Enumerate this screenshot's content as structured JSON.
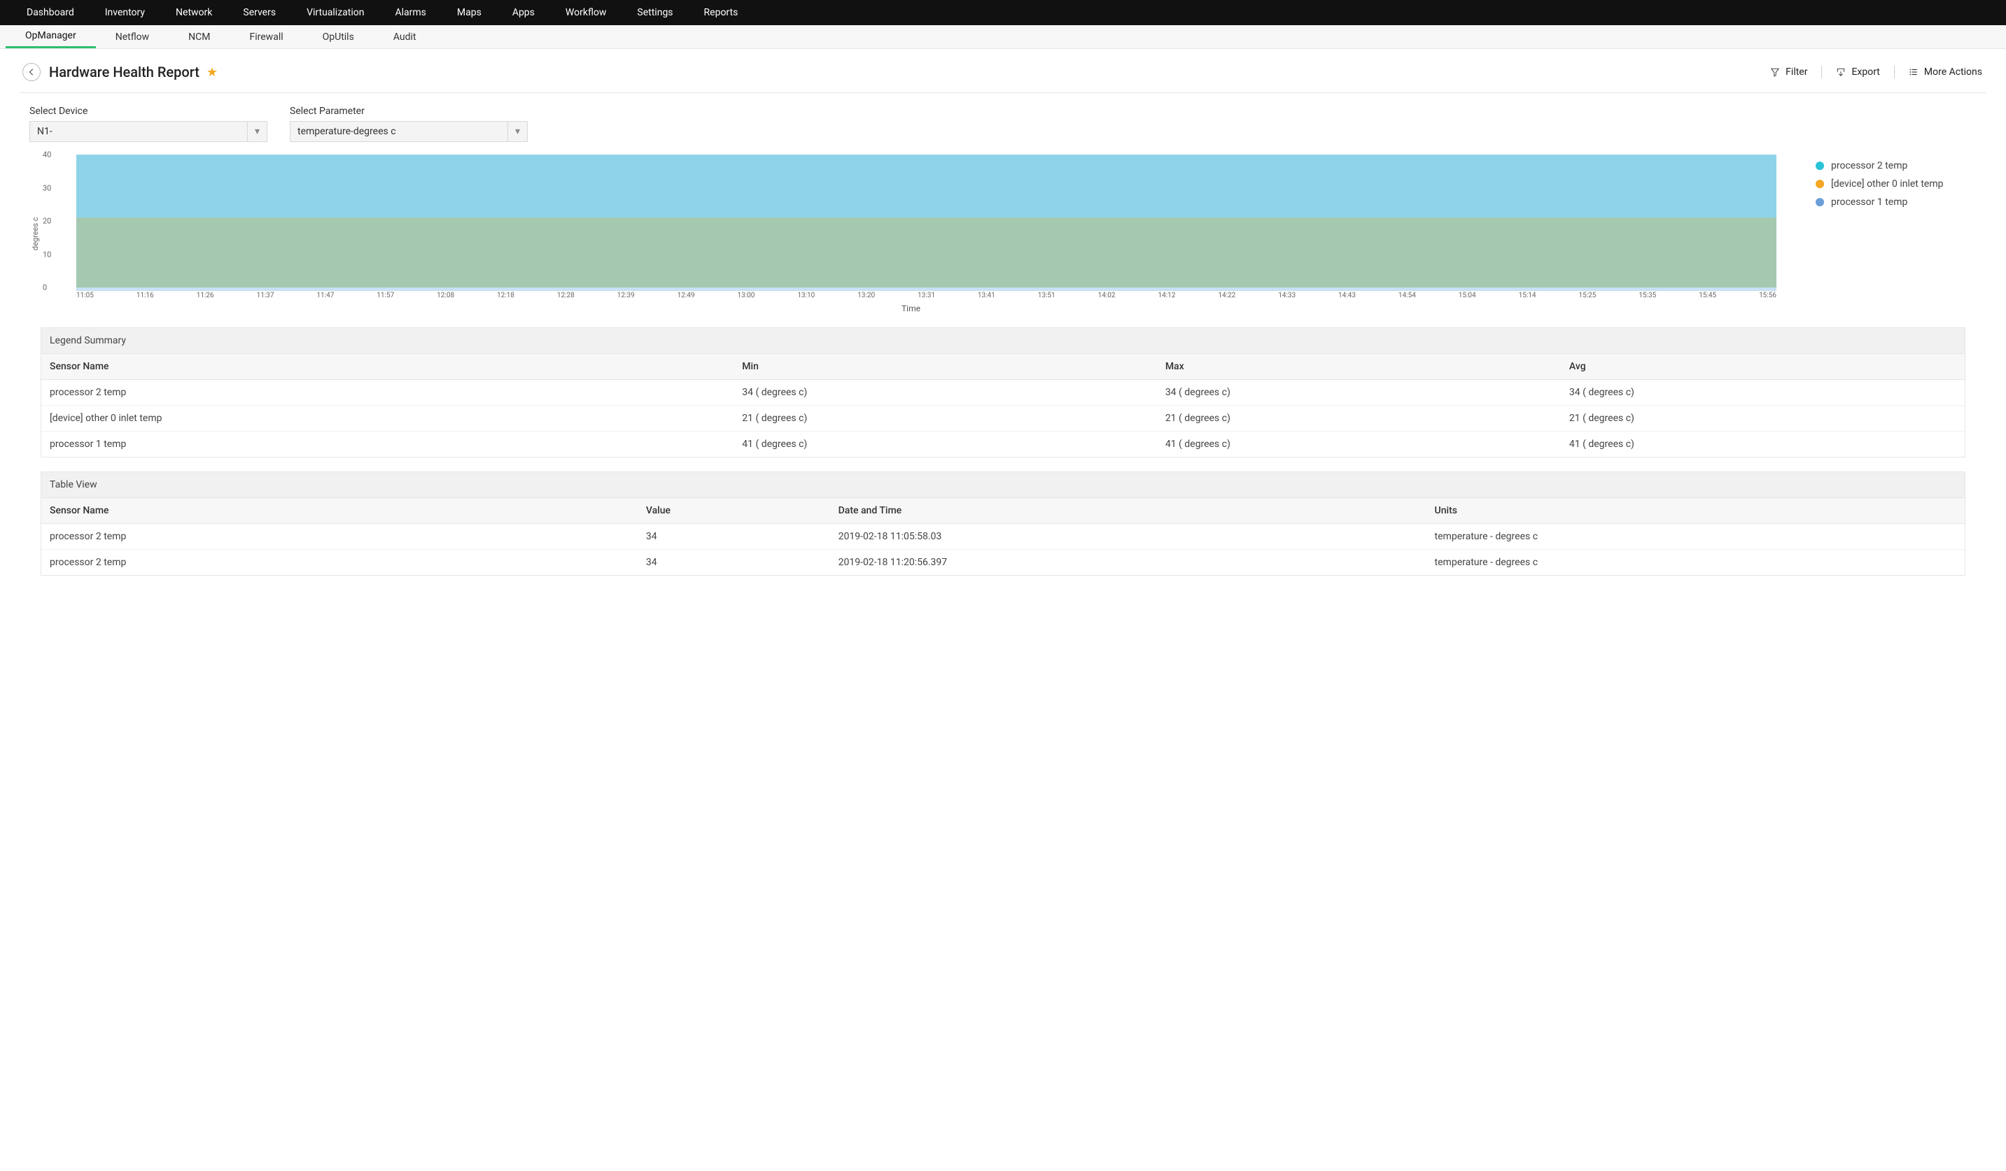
{
  "topnav": [
    "Dashboard",
    "Inventory",
    "Network",
    "Servers",
    "Virtualization",
    "Alarms",
    "Maps",
    "Apps",
    "Workflow",
    "Settings",
    "Reports"
  ],
  "subnav": {
    "items": [
      "OpManager",
      "Netflow",
      "NCM",
      "Firewall",
      "OpUtils",
      "Audit"
    ],
    "active_index": 0
  },
  "header": {
    "title": "Hardware Health Report",
    "actions": {
      "filter": "Filter",
      "export": "Export",
      "more": "More Actions"
    }
  },
  "filters": {
    "device": {
      "label": "Select Device",
      "value": "N1-"
    },
    "parameter": {
      "label": "Select Parameter",
      "value": "temperature-degrees c"
    }
  },
  "chart_data": {
    "type": "area",
    "xlabel": "Time",
    "ylabel": "degrees c",
    "ylim": [
      0,
      40
    ],
    "yticks": [
      0,
      10,
      20,
      30,
      40
    ],
    "categories": [
      "11:05",
      "11:16",
      "11:26",
      "11:37",
      "11:47",
      "11:57",
      "12:08",
      "12:18",
      "12:28",
      "12:39",
      "12:49",
      "13:00",
      "13:10",
      "13:20",
      "13:31",
      "13:41",
      "13:51",
      "14:02",
      "14:12",
      "14:22",
      "14:33",
      "14:43",
      "14:54",
      "15:04",
      "15:14",
      "15:25",
      "15:35",
      "15:45",
      "15:56"
    ],
    "series": [
      {
        "name": "processor 2 temp",
        "color": "#28c3d7",
        "values": [
          34,
          34,
          34,
          34,
          34,
          34,
          34,
          34,
          34,
          34,
          34,
          34,
          34,
          34,
          34,
          34,
          34,
          34,
          34,
          34,
          34,
          34,
          34,
          34,
          34,
          34,
          34,
          34,
          34
        ]
      },
      {
        "name": "[device] other 0 inlet temp",
        "color": "#f5a623",
        "values": [
          21,
          21,
          21,
          21,
          21,
          21,
          21,
          21,
          21,
          21,
          21,
          21,
          21,
          21,
          21,
          21,
          21,
          21,
          21,
          21,
          21,
          21,
          21,
          21,
          21,
          21,
          21,
          21,
          21
        ]
      },
      {
        "name": "processor 1 temp",
        "color": "#6b9fd8",
        "values": [
          41,
          41,
          41,
          41,
          41,
          41,
          41,
          41,
          41,
          41,
          41,
          41,
          41,
          41,
          41,
          41,
          41,
          41,
          41,
          41,
          41,
          41,
          41,
          41,
          41,
          41,
          41,
          41,
          41
        ]
      }
    ]
  },
  "legend_summary": {
    "title": "Legend Summary",
    "columns": [
      "Sensor Name",
      "Min",
      "Max",
      "Avg"
    ],
    "rows": [
      [
        "processor 2 temp",
        "34 ( degrees c)",
        "34 ( degrees c)",
        "34 ( degrees c)"
      ],
      [
        "[device] other 0 inlet temp",
        "21 ( degrees c)",
        "21 ( degrees c)",
        "21 ( degrees c)"
      ],
      [
        "processor 1 temp",
        "41 ( degrees c)",
        "41 ( degrees c)",
        "41 ( degrees c)"
      ]
    ]
  },
  "table_view": {
    "title": "Table View",
    "columns": [
      "Sensor Name",
      "Value",
      "Date and Time",
      "Units"
    ],
    "rows": [
      [
        "processor 2 temp",
        "34",
        "2019-02-18 11:05:58.03",
        "temperature - degrees c"
      ],
      [
        "processor 2 temp",
        "34",
        "2019-02-18 11:20:56.397",
        "temperature - degrees c"
      ]
    ]
  }
}
